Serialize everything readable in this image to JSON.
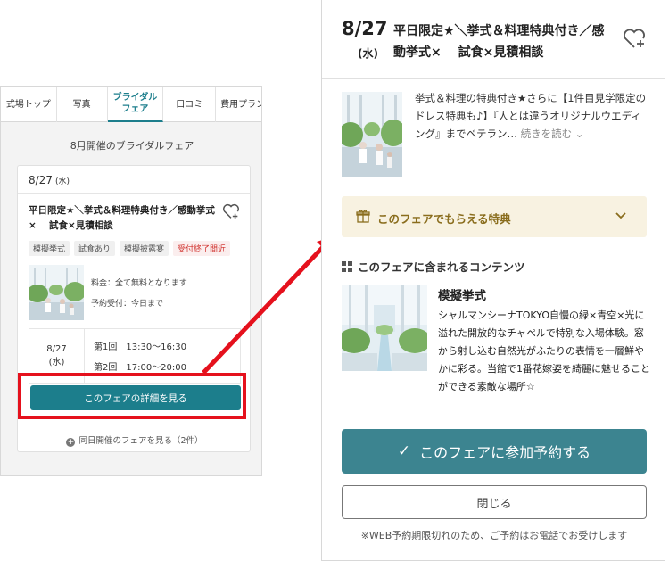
{
  "left": {
    "tabs": [
      {
        "label": "式場トップ"
      },
      {
        "label": "写真"
      },
      {
        "label": "ブライダル\nフェア"
      },
      {
        "label": "口コミ"
      },
      {
        "label": "費用プラン"
      }
    ],
    "month_title": "8月開催のブライダルフェア",
    "card": {
      "date": "8/27",
      "weekday": "(水)",
      "title": "平日限定★＼挙式＆料理特典付き／感動挙式×　 試食×見積相談",
      "tags": [
        "模擬挙式",
        "試食あり",
        "模擬披露宴",
        "受付終了間近"
      ],
      "fee": "料金：全て無料となります",
      "deadline": "予約受付：今日まで",
      "schedule_date": "8/27",
      "schedule_weekday": "(水)",
      "slot1": "第1回　13:30〜16:30",
      "slot2": "第2回　17:00〜20:00",
      "detail_button": "このフェアの詳細を見る",
      "same_day_link": "同日開催のフェアを見る（2件）"
    }
  },
  "right": {
    "date": "8/27",
    "weekday": "(水)",
    "title": "平日限定★＼挙式＆料理特典付き／感動挙式×　 試食×見積相談",
    "description": "挙式＆料理の特典付き★さらに【1件目見学限定のドレス特典も♪】『人とは違うオリジナルウエディング』までベテラン…",
    "more_link": "続きを読む",
    "benefit_label": "このフェアでもらえる特典",
    "contents_heading": "このフェアに含まれるコンテンツ",
    "content_item": {
      "title": "模擬挙式",
      "description": "シャルマンシーナTOKYO自慢の緑×青空×光に溢れた開放的なチャペルで特別な入場体験。窓から射し込む自然光がふたりの表情を一層鮮やかに彩る。当館で1番花嫁姿を綺麗に魅せることができる素敵な場所☆"
    },
    "reserve_button": "このフェアに参加予約する",
    "close_button": "閉じる",
    "note": "※WEB予約期限切れのため、ご予約はお電話でお受けします"
  },
  "colors": {
    "accent": "#1c7e8c",
    "reserve": "#3c8490",
    "highlight": "#e5111d",
    "benefit_bg": "#f8f2e1",
    "benefit_text": "#8a6d1d"
  },
  "icons": [
    "heart-plus-icon",
    "gift-icon",
    "chevron-down-icon",
    "grid-icon",
    "check-icon",
    "plus-circle-icon"
  ]
}
